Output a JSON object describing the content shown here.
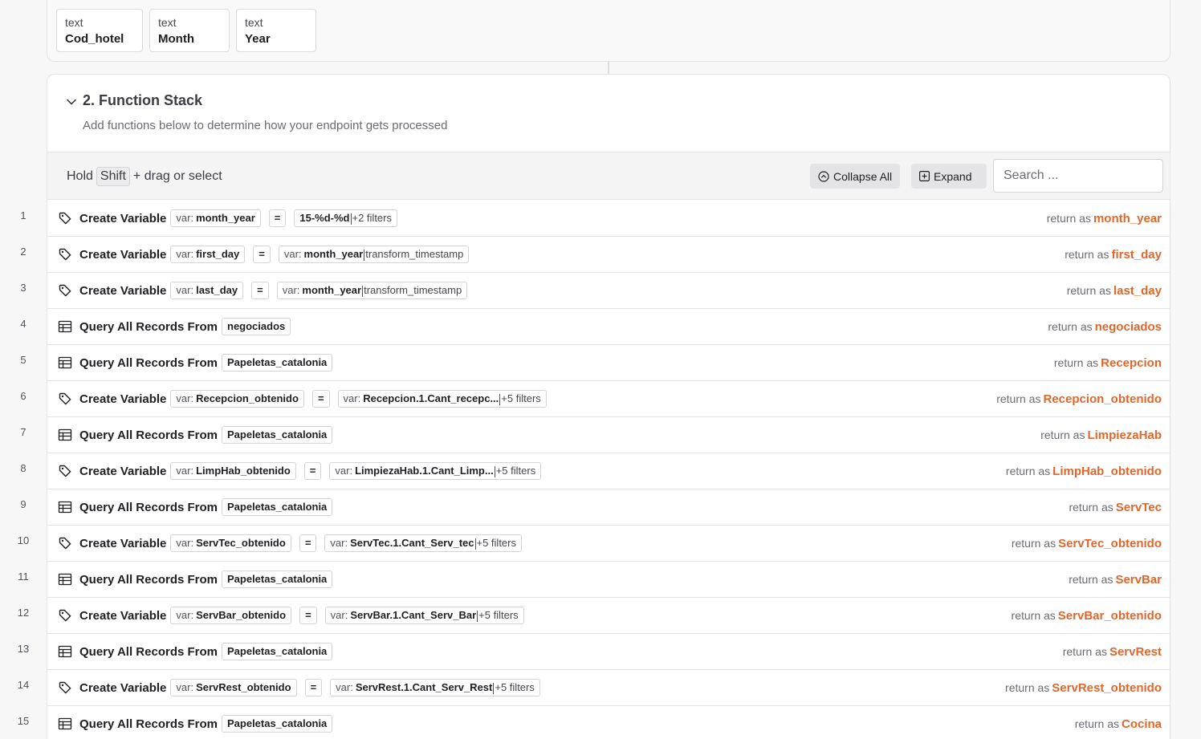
{
  "inputs": [
    {
      "type": "text",
      "name": "Cod_hotel"
    },
    {
      "type": "text",
      "name": "Month"
    },
    {
      "type": "text",
      "name": "Year"
    }
  ],
  "section": {
    "title": "2. Function Stack",
    "subtitle": "Add functions below to determine how your endpoint gets processed"
  },
  "toolbar": {
    "hint_prefix": "Hold",
    "hint_key": "Shift",
    "hint_suffix": "+ drag or select",
    "collapse_label": "Collapse All",
    "expand_label": "Expand",
    "search_placeholder": "Search ..."
  },
  "colors": {
    "accent": "#e0672c",
    "toolbar_bg": "#f4f4f5"
  },
  "return_label": "return as",
  "steps": [
    {
      "no": "1",
      "kind": "create",
      "icon": "tag-icon",
      "fn": "Create Variable",
      "var_label": "var:",
      "var": "month_year",
      "eq": "=",
      "value_label": "",
      "value": "15-%d-%d",
      "value_extra": "+2 filters",
      "return": "month_year"
    },
    {
      "no": "2",
      "kind": "create",
      "icon": "tag-icon",
      "fn": "Create Variable",
      "var_label": "var:",
      "var": "first_day",
      "eq": "=",
      "value_label": "var:",
      "value": "month_year",
      "value_extra": "transform_timestamp",
      "return": "first_day"
    },
    {
      "no": "3",
      "kind": "create",
      "icon": "tag-icon",
      "fn": "Create Variable",
      "var_label": "var:",
      "var": "last_day",
      "eq": "=",
      "value_label": "var:",
      "value": "month_year",
      "value_extra": "transform_timestamp",
      "return": "last_day"
    },
    {
      "no": "4",
      "kind": "query",
      "icon": "table-icon",
      "fn": "Query All Records From",
      "table": "negociados",
      "return": "negociados"
    },
    {
      "no": "5",
      "kind": "query",
      "icon": "table-icon",
      "fn": "Query All Records From",
      "table": "Papeletas_catalonia",
      "return": "Recepcion"
    },
    {
      "no": "6",
      "kind": "create",
      "icon": "tag-icon",
      "fn": "Create Variable",
      "var_label": "var:",
      "var": "Recepcion_obtenido",
      "eq": "=",
      "value_label": "var:",
      "value": "Recepcion.1.Cant_recepc...",
      "value_extra": "+5 filters",
      "return": "Recepcion_obtenido"
    },
    {
      "no": "7",
      "kind": "query",
      "icon": "table-icon",
      "fn": "Query All Records From",
      "table": "Papeletas_catalonia",
      "return": "LimpiezaHab"
    },
    {
      "no": "8",
      "kind": "create",
      "icon": "tag-icon",
      "fn": "Create Variable",
      "var_label": "var:",
      "var": "LimpHab_obtenido",
      "eq": "=",
      "value_label": "var:",
      "value": "LimpiezaHab.1.Cant_Limp...",
      "value_extra": "+5 filters",
      "return": "LimpHab_obtenido"
    },
    {
      "no": "9",
      "kind": "query",
      "icon": "table-icon",
      "fn": "Query All Records From",
      "table": "Papeletas_catalonia",
      "return": "ServTec"
    },
    {
      "no": "10",
      "kind": "create",
      "icon": "tag-icon",
      "fn": "Create Variable",
      "var_label": "var:",
      "var": "ServTec_obtenido",
      "eq": "=",
      "value_label": "var:",
      "value": "ServTec.1.Cant_Serv_tec",
      "value_extra": "+5 filters",
      "return": "ServTec_obtenido"
    },
    {
      "no": "11",
      "kind": "query",
      "icon": "table-icon",
      "fn": "Query All Records From",
      "table": "Papeletas_catalonia",
      "return": "ServBar"
    },
    {
      "no": "12",
      "kind": "create",
      "icon": "tag-icon",
      "fn": "Create Variable",
      "var_label": "var:",
      "var": "ServBar_obtenido",
      "eq": "=",
      "value_label": "var:",
      "value": "ServBar.1.Cant_Serv_Bar",
      "value_extra": "+5 filters",
      "return": "ServBar_obtenido"
    },
    {
      "no": "13",
      "kind": "query",
      "icon": "table-icon",
      "fn": "Query All Records From",
      "table": "Papeletas_catalonia",
      "return": "ServRest"
    },
    {
      "no": "14",
      "kind": "create",
      "icon": "tag-icon",
      "fn": "Create Variable",
      "var_label": "var:",
      "var": "ServRest_obtenido",
      "eq": "=",
      "value_label": "var:",
      "value": "ServRest.1.Cant_Serv_Rest",
      "value_extra": "+5 filters",
      "return": "ServRest_obtenido"
    },
    {
      "no": "15",
      "kind": "query",
      "icon": "table-icon",
      "fn": "Query All Records From",
      "table": "Papeletas_catalonia",
      "return": "Cocina"
    }
  ]
}
